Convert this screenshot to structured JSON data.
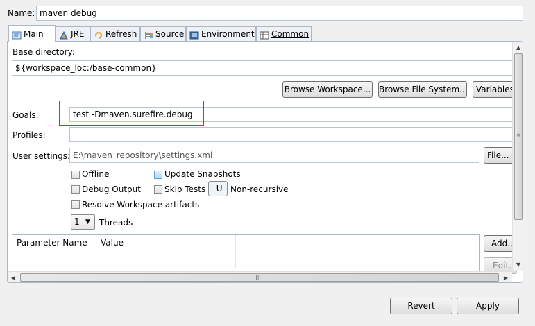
{
  "name": {
    "label": "Name:",
    "value": "maven debug"
  },
  "tabs": [
    {
      "label": "Main",
      "icon": "main-tab-icon"
    },
    {
      "label": "JRE",
      "icon": "jre-icon"
    },
    {
      "label": "Refresh",
      "icon": "refresh-icon"
    },
    {
      "label": "Source",
      "icon": "source-icon"
    },
    {
      "label": "Environment",
      "icon": "environment-icon"
    },
    {
      "label": "Common",
      "icon": "common-icon"
    }
  ],
  "main": {
    "base_directory": {
      "label": "Base directory:",
      "value": "${workspace_loc:/base-common}",
      "browse_workspace": "Browse Workspace...",
      "browse_file_system": "Browse File System...",
      "variables": "Variables..."
    },
    "goals": {
      "label": "Goals:",
      "value": "test -Dmaven.surefire.debug"
    },
    "profiles": {
      "label": "Profiles:",
      "value": ""
    },
    "user_settings": {
      "label": "User settings:",
      "value": "E:\\maven_repository\\settings.xml",
      "file_button": "File..."
    },
    "options": {
      "offline": "Offline",
      "update_snapshots": "Update Snapshots",
      "debug_output": "Debug Output",
      "skip_tests": "Skip Tests",
      "non_recursive_badge": "-U",
      "non_recursive": "Non-recursive",
      "resolve_workspace": "Resolve Workspace artifacts"
    },
    "threads": {
      "value": "1",
      "label": "Threads"
    },
    "params_table": {
      "columns": [
        "Parameter Name",
        "Value"
      ],
      "add_button": "Add...",
      "edit_button": "Edit..."
    }
  },
  "footer": {
    "revert": "Revert",
    "apply": "Apply"
  },
  "colors": {
    "highlight_box": "#e0252b",
    "field_border": "#b8c5d6"
  }
}
